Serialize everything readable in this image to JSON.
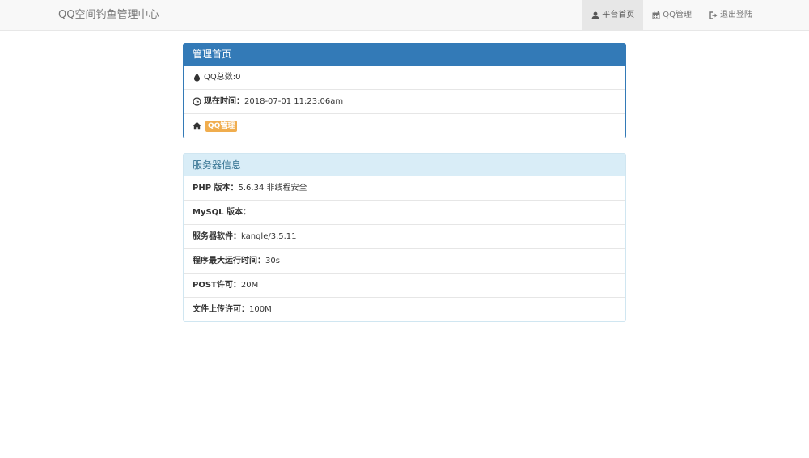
{
  "navbar": {
    "brand": "QQ空间钓鱼管理中心",
    "items": [
      {
        "label": "平台首页",
        "icon": "user-icon",
        "active": true
      },
      {
        "label": "QQ管理",
        "icon": "calendar-icon",
        "active": false
      },
      {
        "label": "退出登陆",
        "icon": "logout-icon",
        "active": false
      }
    ]
  },
  "admin_panel": {
    "title": "管理首页",
    "qq_total_label": "QQ总数:",
    "qq_total_value": "0",
    "time_label": "现在时间：",
    "time_value": "2018-07-01 11:23:06am",
    "qq_manage_badge": "QQ管理"
  },
  "server_panel": {
    "title": "服务器信息",
    "rows": [
      {
        "label": "PHP 版本：",
        "value": "5.6.34 非线程安全"
      },
      {
        "label": "MySQL 版本：",
        "value": ""
      },
      {
        "label": "服务器软件：",
        "value": "kangle/3.5.11"
      },
      {
        "label": "程序最大运行时间：",
        "value": "30s"
      },
      {
        "label": "POST许可：",
        "value": "20M"
      },
      {
        "label": "文件上传许可：",
        "value": "100M"
      }
    ]
  },
  "colors": {
    "primary": "#337ab7",
    "info_bg": "#d9edf7",
    "warning": "#f0ad4e"
  }
}
